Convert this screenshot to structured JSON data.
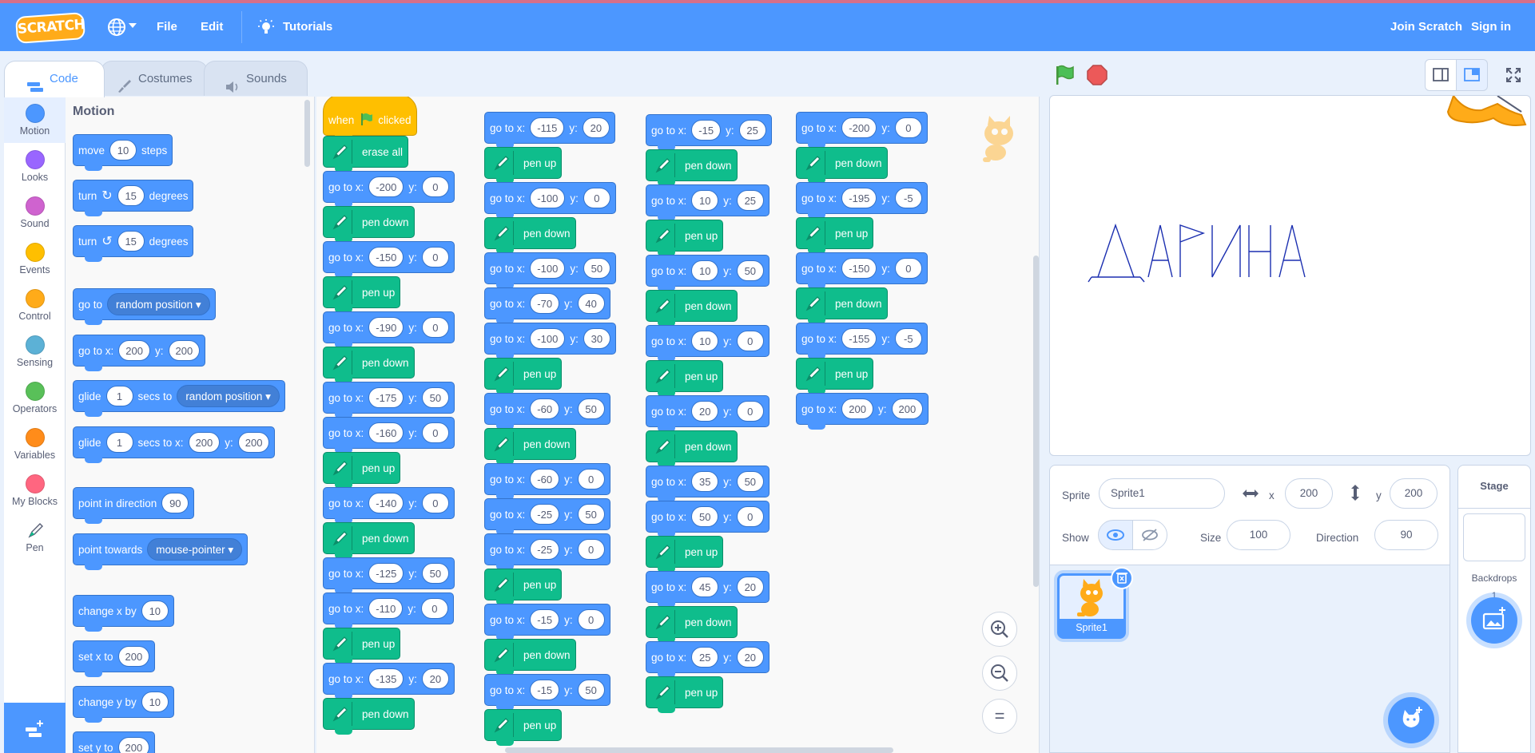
{
  "menu": {
    "logo": "SCRATCH",
    "file": "File",
    "edit": "Edit",
    "tutorials": "Tutorials",
    "join": "Join Scratch",
    "signin": "Sign in"
  },
  "tabs": {
    "code": "Code",
    "costumes": "Costumes",
    "sounds": "Sounds"
  },
  "categories": [
    {
      "label": "Motion",
      "color": "#4c97ff"
    },
    {
      "label": "Looks",
      "color": "#9966ff"
    },
    {
      "label": "Sound",
      "color": "#cf63cf"
    },
    {
      "label": "Events",
      "color": "#ffbf00"
    },
    {
      "label": "Control",
      "color": "#ffab19"
    },
    {
      "label": "Sensing",
      "color": "#5cb1d6"
    },
    {
      "label": "Operators",
      "color": "#59c059"
    },
    {
      "label": "Variables",
      "color": "#ff8c1a"
    },
    {
      "label": "My Blocks",
      "color": "#ff6680"
    },
    {
      "label": "Pen",
      "color": "#0fbd8c"
    }
  ],
  "palette": {
    "title": "Motion",
    "move": {
      "a": "move",
      "v": "10",
      "b": "steps"
    },
    "turn_right": {
      "a": "turn",
      "v": "15",
      "b": "degrees"
    },
    "turn_left": {
      "a": "turn",
      "v": "15",
      "b": "degrees"
    },
    "goto": {
      "a": "go to",
      "dd": "random position"
    },
    "gotoxy": {
      "a": "go to x:",
      "x": "200",
      "b": "y:",
      "y": "200"
    },
    "glide": {
      "a": "glide",
      "v": "1",
      "b": "secs to",
      "dd": "random position"
    },
    "glidexy": {
      "a": "glide",
      "v": "1",
      "b": "secs to x:",
      "x": "200",
      "c": "y:",
      "y": "200"
    },
    "pointdir": {
      "a": "point in direction",
      "v": "90"
    },
    "pointtow": {
      "a": "point towards",
      "dd": "mouse-pointer"
    },
    "changex": {
      "a": "change x by",
      "v": "10"
    },
    "setx": {
      "a": "set x to",
      "v": "200"
    },
    "changey": {
      "a": "change y by",
      "v": "10"
    },
    "sety": {
      "a": "set y to",
      "v": "200"
    }
  },
  "labels": {
    "gotox": "go to x:",
    "y": "y:",
    "penup": "pen up",
    "pendown": "pen down",
    "erase": "erase all",
    "when": "when",
    "clicked": "clicked"
  },
  "scripts": [
    [
      {
        "t": "hat"
      },
      {
        "t": "erase"
      },
      {
        "t": "go",
        "x": "-200",
        "y": "0"
      },
      {
        "t": "pd"
      },
      {
        "t": "go",
        "x": "-150",
        "y": "0"
      },
      {
        "t": "pu"
      },
      {
        "t": "go",
        "x": "-190",
        "y": "0"
      },
      {
        "t": "pd"
      },
      {
        "t": "go",
        "x": "-175",
        "y": "50"
      },
      {
        "t": "go",
        "x": "-160",
        "y": "0"
      },
      {
        "t": "pu"
      },
      {
        "t": "go",
        "x": "-140",
        "y": "0"
      },
      {
        "t": "pd"
      },
      {
        "t": "go",
        "x": "-125",
        "y": "50"
      },
      {
        "t": "go",
        "x": "-110",
        "y": "0"
      },
      {
        "t": "pu"
      },
      {
        "t": "go",
        "x": "-135",
        "y": "20"
      },
      {
        "t": "pd"
      }
    ],
    [
      {
        "t": "go",
        "x": "-115",
        "y": "20"
      },
      {
        "t": "pu"
      },
      {
        "t": "go",
        "x": "-100",
        "y": "0"
      },
      {
        "t": "pd"
      },
      {
        "t": "go",
        "x": "-100",
        "y": "50"
      },
      {
        "t": "go",
        "x": "-70",
        "y": "40"
      },
      {
        "t": "go",
        "x": "-100",
        "y": "30"
      },
      {
        "t": "pu"
      },
      {
        "t": "go",
        "x": "-60",
        "y": "50"
      },
      {
        "t": "pd"
      },
      {
        "t": "go",
        "x": "-60",
        "y": "0"
      },
      {
        "t": "go",
        "x": "-25",
        "y": "50"
      },
      {
        "t": "go",
        "x": "-25",
        "y": "0"
      },
      {
        "t": "pu"
      },
      {
        "t": "go",
        "x": "-15",
        "y": "0"
      },
      {
        "t": "pd"
      },
      {
        "t": "go",
        "x": "-15",
        "y": "50"
      },
      {
        "t": "pu"
      }
    ],
    [
      {
        "t": "go",
        "x": "-15",
        "y": "25"
      },
      {
        "t": "pd"
      },
      {
        "t": "go",
        "x": "10",
        "y": "25"
      },
      {
        "t": "pu"
      },
      {
        "t": "go",
        "x": "10",
        "y": "50"
      },
      {
        "t": "pd"
      },
      {
        "t": "go",
        "x": "10",
        "y": "0"
      },
      {
        "t": "pu"
      },
      {
        "t": "go",
        "x": "20",
        "y": "0"
      },
      {
        "t": "pd"
      },
      {
        "t": "go",
        "x": "35",
        "y": "50"
      },
      {
        "t": "go",
        "x": "50",
        "y": "0"
      },
      {
        "t": "pu"
      },
      {
        "t": "go",
        "x": "45",
        "y": "20"
      },
      {
        "t": "pd"
      },
      {
        "t": "go",
        "x": "25",
        "y": "20"
      },
      {
        "t": "pu"
      }
    ],
    [
      {
        "t": "go",
        "x": "-200",
        "y": "0"
      },
      {
        "t": "pd"
      },
      {
        "t": "go",
        "x": "-195",
        "y": "-5"
      },
      {
        "t": "pu"
      },
      {
        "t": "go",
        "x": "-150",
        "y": "0"
      },
      {
        "t": "pd"
      },
      {
        "t": "go",
        "x": "-155",
        "y": "-5"
      },
      {
        "t": "pu"
      },
      {
        "t": "go",
        "x": "200",
        "y": "200"
      }
    ]
  ],
  "stage_text": "ДАРИНА",
  "sprite": {
    "label": "Sprite",
    "name": "Sprite1",
    "x_label": "x",
    "x": "200",
    "y_label": "y",
    "y": "200",
    "show": "Show",
    "size_label": "Size",
    "size": "100",
    "dir_label": "Direction",
    "dir": "90",
    "thumb_name": "Sprite1"
  },
  "stagepane": {
    "title": "Stage",
    "backdrops": "Backdrops",
    "count": "1"
  },
  "zoom": {
    "in": "+",
    "out": "−",
    "reset": "="
  },
  "colors": {
    "motion": "#4c97ff",
    "pen": "#0fbd8c",
    "events": "#ffbf00",
    "menubar": "#4c97ff"
  }
}
